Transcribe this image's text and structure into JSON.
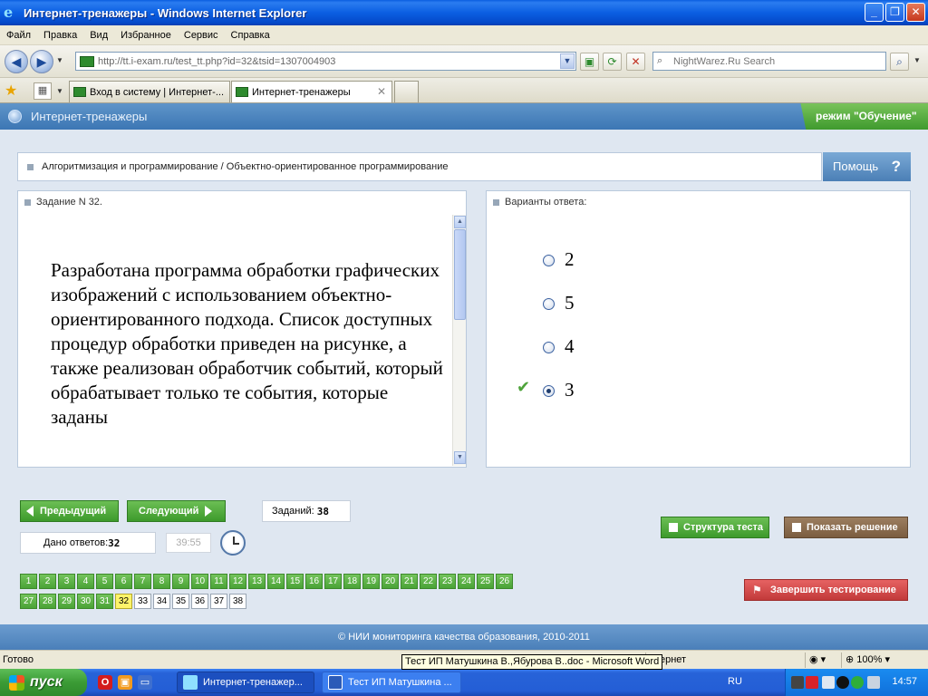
{
  "window": {
    "title": "Интернет-тренажеры - Windows Internet Explorer",
    "minimize": "_",
    "maximize": "❐",
    "close": "✕"
  },
  "menu": [
    "Файл",
    "Правка",
    "Вид",
    "Избранное",
    "Сервис",
    "Справка"
  ],
  "address": {
    "url": "http://tt.i-exam.ru/test_tt.php?id=32&tsid=1307004903",
    "search_placeholder": "NightWarez.Ru Search"
  },
  "tabs": [
    {
      "label": "Вход в систему | Интернет-...",
      "active": false
    },
    {
      "label": "Интернет-тренажеры",
      "active": true
    }
  ],
  "site": {
    "name": "Интернет-тренажеры",
    "mode": "режим \"Обучение\"",
    "breadcrumb": "Алгоритмизация и программирование / Объектно-ориентированное программирование",
    "help_label": "Помощь",
    "help_icon": "?",
    "footer": "© НИИ мониторинга качества образования, 2010-2011"
  },
  "task": {
    "header": "Задание N 32.",
    "text": "Разработана программа обработки графических изображений с использованием объектно-ориентированного подхода. Список доступных процедур обработки приведен на рисунке, а также реализован обработчик событий, который обрабатывает только те события, которые заданы"
  },
  "answers": {
    "header": "Варианты ответа:",
    "options": [
      {
        "label": "2",
        "selected": false,
        "correct": false
      },
      {
        "label": "5",
        "selected": false,
        "correct": false
      },
      {
        "label": "4",
        "selected": false,
        "correct": false
      },
      {
        "label": "3",
        "selected": true,
        "correct": true
      }
    ]
  },
  "controls": {
    "prev": "Предыдущий",
    "next": "Следующий",
    "tasks_label": "Заданий:",
    "tasks_count": "38",
    "answered_label": "Дано ответов:",
    "answered_count": "32",
    "timer": "39:55",
    "structure": "Структура теста",
    "show_solution": "Показать решение",
    "finish": "Завершить тестирование"
  },
  "questions": {
    "numbers": [
      "1",
      "2",
      "3",
      "4",
      "5",
      "6",
      "7",
      "8",
      "9",
      "10",
      "11",
      "12",
      "13",
      "14",
      "15",
      "16",
      "17",
      "18",
      "19",
      "20",
      "21",
      "22",
      "23",
      "24",
      "25",
      "26",
      "27",
      "28",
      "29",
      "30",
      "31",
      "32",
      "33",
      "34",
      "35",
      "36",
      "37",
      "38"
    ],
    "current": "32",
    "answered_through": 31
  },
  "status": {
    "text": "Готово",
    "zone": "нтернет",
    "zoom": "100%"
  },
  "tooltip": "Тест ИП Матушкина В.,Ябурова В..doc - Microsoft Word",
  "taskbar": {
    "start": "пуск",
    "items": [
      "Интернет-тренажер...",
      "Тест ИП Матушкина ..."
    ],
    "lang": "RU",
    "clock": "14:57"
  },
  "colors": {
    "green": "#4aa336",
    "header_blue": "#3c76b4",
    "finish_red": "#d94545",
    "solution_brown": "#8a6a4c"
  }
}
